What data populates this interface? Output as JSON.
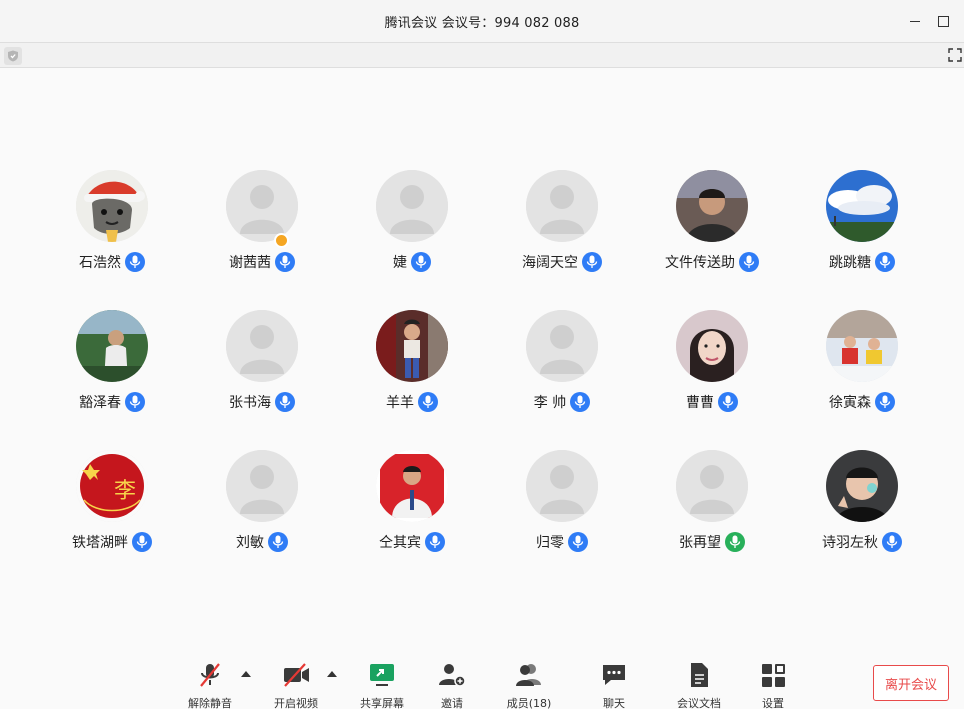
{
  "window": {
    "title": "腾讯会议 会议号：994 082 088"
  },
  "participants": [
    {
      "name": "石浩然",
      "avatar": "santa-hat-avatar",
      "mic": "on"
    },
    {
      "name": "谢茜茜",
      "avatar": "default-avatar",
      "mic": "on",
      "host": true
    },
    {
      "name": "婕",
      "avatar": "default-avatar",
      "mic": "on"
    },
    {
      "name": "海阔天空",
      "avatar": "default-avatar",
      "mic": "on"
    },
    {
      "name": "文件传送助",
      "avatar": "man-photo-avatar",
      "mic": "on"
    },
    {
      "name": "跳跳糖",
      "avatar": "sky-photo-avatar",
      "mic": "on"
    },
    {
      "name": "豁泽春",
      "avatar": "outdoor-man-avatar",
      "mic": "on"
    },
    {
      "name": "张书海",
      "avatar": "default-avatar",
      "mic": "on"
    },
    {
      "name": "羊羊",
      "avatar": "child-photo-avatar",
      "mic": "on"
    },
    {
      "name": "李 帅",
      "avatar": "default-avatar",
      "mic": "on"
    },
    {
      "name": "曹曹",
      "avatar": "woman-photo-avatar",
      "mic": "on"
    },
    {
      "name": "徐寅森",
      "avatar": "snow-photo-avatar",
      "mic": "on"
    },
    {
      "name": "铁塔湖畔",
      "avatar": "red-seal-avatar",
      "mic": "on"
    },
    {
      "name": "刘敏",
      "avatar": "default-avatar",
      "mic": "on"
    },
    {
      "name": "仝其宾",
      "avatar": "red-bg-man-avatar",
      "mic": "on"
    },
    {
      "name": "归零",
      "avatar": "default-avatar",
      "mic": "on"
    },
    {
      "name": "张再望",
      "avatar": "default-avatar",
      "mic": "speaking"
    },
    {
      "name": "诗羽左秋",
      "avatar": "selfie-man-avatar",
      "mic": "on"
    }
  ],
  "toolbar": {
    "mute": "解除静音",
    "video": "开启视频",
    "share": "共享屏幕",
    "invite": "邀请",
    "members": "成员(18)",
    "chat": "聊天",
    "docs": "会议文档",
    "settings": "设置",
    "leave": "离开会议"
  },
  "colors": {
    "mic_blue": "#2f7cf6",
    "mic_green": "#28b05a",
    "leave_red": "#e84a4a",
    "host_badge": "#f5a623",
    "share_green": "#1aa260"
  }
}
